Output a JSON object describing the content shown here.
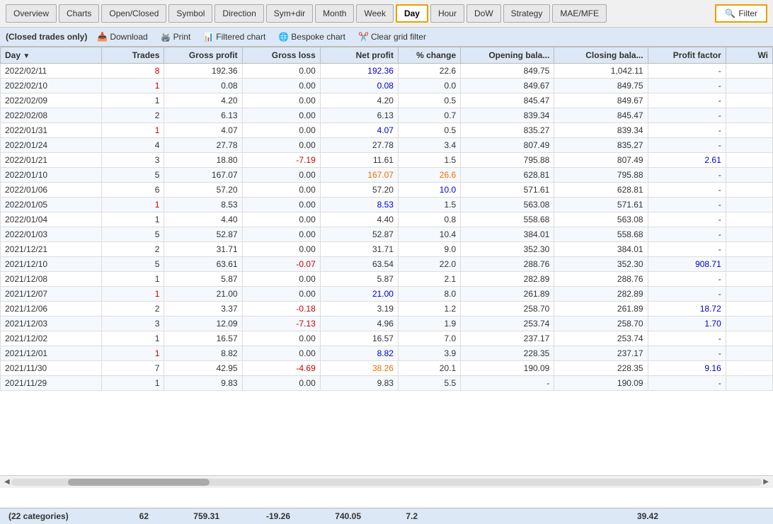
{
  "tabs": [
    {
      "label": "Overview",
      "active": false
    },
    {
      "label": "Charts",
      "active": false
    },
    {
      "label": "Open/Closed",
      "active": false
    },
    {
      "label": "Symbol",
      "active": false
    },
    {
      "label": "Direction",
      "active": false
    },
    {
      "label": "Sym+dir",
      "active": false
    },
    {
      "label": "Month",
      "active": false
    },
    {
      "label": "Week",
      "active": false
    },
    {
      "label": "Day",
      "active": true
    },
    {
      "label": "Hour",
      "active": false
    },
    {
      "label": "DoW",
      "active": false
    },
    {
      "label": "Strategy",
      "active": false
    },
    {
      "label": "MAE/MFE",
      "active": false
    }
  ],
  "filter_label": "Filter",
  "subbar": {
    "label": "(Closed trades only)",
    "download": "Download",
    "print": "Print",
    "filtered_chart": "Filtered chart",
    "bespoke_chart": "Bespoke chart",
    "clear_grid": "Clear grid filter"
  },
  "columns": [
    "Day",
    "Trades",
    "Gross profit",
    "Gross loss",
    "Net profit",
    "% change",
    "Opening bala...",
    "Closing bala...",
    "Profit factor",
    "Wi"
  ],
  "rows": [
    {
      "day": "2022/02/11",
      "trades": "8",
      "gross_profit": "192.36",
      "gross_loss": "0.00",
      "net_profit": "192.36",
      "pct_change": "22.6",
      "opening_bal": "849.75",
      "closing_bal": "1,042.11",
      "profit_factor": "-",
      "wi": "",
      "trades_color": "red",
      "net_color": "blue",
      "pct_color": "normal"
    },
    {
      "day": "2022/02/10",
      "trades": "1",
      "gross_profit": "0.08",
      "gross_loss": "0.00",
      "net_profit": "0.08",
      "pct_change": "0.0",
      "opening_bal": "849.67",
      "closing_bal": "849.75",
      "profit_factor": "-",
      "wi": "",
      "trades_color": "red",
      "net_color": "blue",
      "pct_color": "normal"
    },
    {
      "day": "2022/02/09",
      "trades": "1",
      "gross_profit": "4.20",
      "gross_loss": "0.00",
      "net_profit": "4.20",
      "pct_change": "0.5",
      "opening_bal": "845.47",
      "closing_bal": "849.67",
      "profit_factor": "-",
      "wi": "",
      "trades_color": "normal",
      "net_color": "normal",
      "pct_color": "normal"
    },
    {
      "day": "2022/02/08",
      "trades": "2",
      "gross_profit": "6.13",
      "gross_loss": "0.00",
      "net_profit": "6.13",
      "pct_change": "0.7",
      "opening_bal": "839.34",
      "closing_bal": "845.47",
      "profit_factor": "-",
      "wi": "",
      "trades_color": "normal",
      "net_color": "normal",
      "pct_color": "normal"
    },
    {
      "day": "2022/01/31",
      "trades": "1",
      "gross_profit": "4.07",
      "gross_loss": "0.00",
      "net_profit": "4.07",
      "pct_change": "0.5",
      "opening_bal": "835.27",
      "closing_bal": "839.34",
      "profit_factor": "-",
      "wi": "",
      "trades_color": "red",
      "net_color": "blue",
      "pct_color": "normal"
    },
    {
      "day": "2022/01/24",
      "trades": "4",
      "gross_profit": "27.78",
      "gross_loss": "0.00",
      "net_profit": "27.78",
      "pct_change": "3.4",
      "opening_bal": "807.49",
      "closing_bal": "835.27",
      "profit_factor": "-",
      "wi": "",
      "trades_color": "normal",
      "net_color": "normal",
      "pct_color": "normal"
    },
    {
      "day": "2022/01/21",
      "trades": "3",
      "gross_profit": "18.80",
      "gross_loss": "-7.19",
      "net_profit": "11.61",
      "pct_change": "1.5",
      "opening_bal": "795.88",
      "closing_bal": "807.49",
      "profit_factor": "2.61",
      "wi": "",
      "trades_color": "normal",
      "net_color": "normal",
      "pct_color": "normal"
    },
    {
      "day": "2022/01/10",
      "trades": "5",
      "gross_profit": "167.07",
      "gross_loss": "0.00",
      "net_profit": "167.07",
      "pct_change": "26.6",
      "opening_bal": "628.81",
      "closing_bal": "795.88",
      "profit_factor": "-",
      "wi": "",
      "trades_color": "normal",
      "net_color": "orange",
      "pct_color": "orange"
    },
    {
      "day": "2022/01/06",
      "trades": "6",
      "gross_profit": "57.20",
      "gross_loss": "0.00",
      "net_profit": "57.20",
      "pct_change": "10.0",
      "opening_bal": "571.61",
      "closing_bal": "628.81",
      "profit_factor": "-",
      "wi": "",
      "trades_color": "normal",
      "net_color": "normal",
      "pct_color": "blue"
    },
    {
      "day": "2022/01/05",
      "trades": "1",
      "gross_profit": "8.53",
      "gross_loss": "0.00",
      "net_profit": "8.53",
      "pct_change": "1.5",
      "opening_bal": "563.08",
      "closing_bal": "571.61",
      "profit_factor": "-",
      "wi": "",
      "trades_color": "red",
      "net_color": "blue",
      "pct_color": "normal"
    },
    {
      "day": "2022/01/04",
      "trades": "1",
      "gross_profit": "4.40",
      "gross_loss": "0.00",
      "net_profit": "4.40",
      "pct_change": "0.8",
      "opening_bal": "558.68",
      "closing_bal": "563.08",
      "profit_factor": "-",
      "wi": "",
      "trades_color": "normal",
      "net_color": "normal",
      "pct_color": "normal"
    },
    {
      "day": "2022/01/03",
      "trades": "5",
      "gross_profit": "52.87",
      "gross_loss": "0.00",
      "net_profit": "52.87",
      "pct_change": "10.4",
      "opening_bal": "384.01",
      "closing_bal": "558.68",
      "profit_factor": "-",
      "wi": "",
      "trades_color": "normal",
      "net_color": "normal",
      "pct_color": "normal"
    },
    {
      "day": "2021/12/21",
      "trades": "2",
      "gross_profit": "31.71",
      "gross_loss": "0.00",
      "net_profit": "31.71",
      "pct_change": "9.0",
      "opening_bal": "352.30",
      "closing_bal": "384.01",
      "profit_factor": "-",
      "wi": "",
      "trades_color": "normal",
      "net_color": "normal",
      "pct_color": "normal"
    },
    {
      "day": "2021/12/10",
      "trades": "5",
      "gross_profit": "63.61",
      "gross_loss": "-0.07",
      "net_profit": "63.54",
      "pct_change": "22.0",
      "opening_bal": "288.76",
      "closing_bal": "352.30",
      "profit_factor": "908.71",
      "wi": "",
      "trades_color": "normal",
      "net_color": "normal",
      "pct_color": "normal"
    },
    {
      "day": "2021/12/08",
      "trades": "1",
      "gross_profit": "5.87",
      "gross_loss": "0.00",
      "net_profit": "5.87",
      "pct_change": "2.1",
      "opening_bal": "282.89",
      "closing_bal": "288.76",
      "profit_factor": "-",
      "wi": "",
      "trades_color": "normal",
      "net_color": "normal",
      "pct_color": "normal"
    },
    {
      "day": "2021/12/07",
      "trades": "1",
      "gross_profit": "21.00",
      "gross_loss": "0.00",
      "net_profit": "21.00",
      "pct_change": "8.0",
      "opening_bal": "261.89",
      "closing_bal": "282.89",
      "profit_factor": "-",
      "wi": "",
      "trades_color": "red",
      "net_color": "blue",
      "pct_color": "normal"
    },
    {
      "day": "2021/12/06",
      "trades": "2",
      "gross_profit": "3.37",
      "gross_loss": "-0.18",
      "net_profit": "3.19",
      "pct_change": "1.2",
      "opening_bal": "258.70",
      "closing_bal": "261.89",
      "profit_factor": "18.72",
      "wi": "",
      "trades_color": "normal",
      "net_color": "normal",
      "pct_color": "normal"
    },
    {
      "day": "2021/12/03",
      "trades": "3",
      "gross_profit": "12.09",
      "gross_loss": "-7.13",
      "net_profit": "4.96",
      "pct_change": "1.9",
      "opening_bal": "253.74",
      "closing_bal": "258.70",
      "profit_factor": "1.70",
      "wi": "",
      "trades_color": "normal",
      "net_color": "normal",
      "pct_color": "normal"
    },
    {
      "day": "2021/12/02",
      "trades": "1",
      "gross_profit": "16.57",
      "gross_loss": "0.00",
      "net_profit": "16.57",
      "pct_change": "7.0",
      "opening_bal": "237.17",
      "closing_bal": "253.74",
      "profit_factor": "-",
      "wi": "",
      "trades_color": "normal",
      "net_color": "normal",
      "pct_color": "normal"
    },
    {
      "day": "2021/12/01",
      "trades": "1",
      "gross_profit": "8.82",
      "gross_loss": "0.00",
      "net_profit": "8.82",
      "pct_change": "3.9",
      "opening_bal": "228.35",
      "closing_bal": "237.17",
      "profit_factor": "-",
      "wi": "",
      "trades_color": "red",
      "net_color": "blue",
      "pct_color": "normal"
    },
    {
      "day": "2021/11/30",
      "trades": "7",
      "gross_profit": "42.95",
      "gross_loss": "-4.69",
      "net_profit": "38.26",
      "pct_change": "20.1",
      "opening_bal": "190.09",
      "closing_bal": "228.35",
      "profit_factor": "9.16",
      "wi": "",
      "trades_color": "normal",
      "net_color": "orange",
      "pct_color": "normal"
    },
    {
      "day": "2021/11/29",
      "trades": "1",
      "gross_profit": "9.83",
      "gross_loss": "0.00",
      "net_profit": "9.83",
      "pct_change": "5.5",
      "opening_bal": "-",
      "closing_bal": "190.09",
      "profit_factor": "-",
      "wi": "",
      "trades_color": "normal",
      "net_color": "normal",
      "pct_color": "normal"
    }
  ],
  "footer": {
    "label": "(22 categories)",
    "trades": "62",
    "gross_profit": "759.31",
    "gross_loss": "-19.26",
    "net_profit": "740.05",
    "pct_change": "7.2",
    "profit_factor": "39.42"
  }
}
